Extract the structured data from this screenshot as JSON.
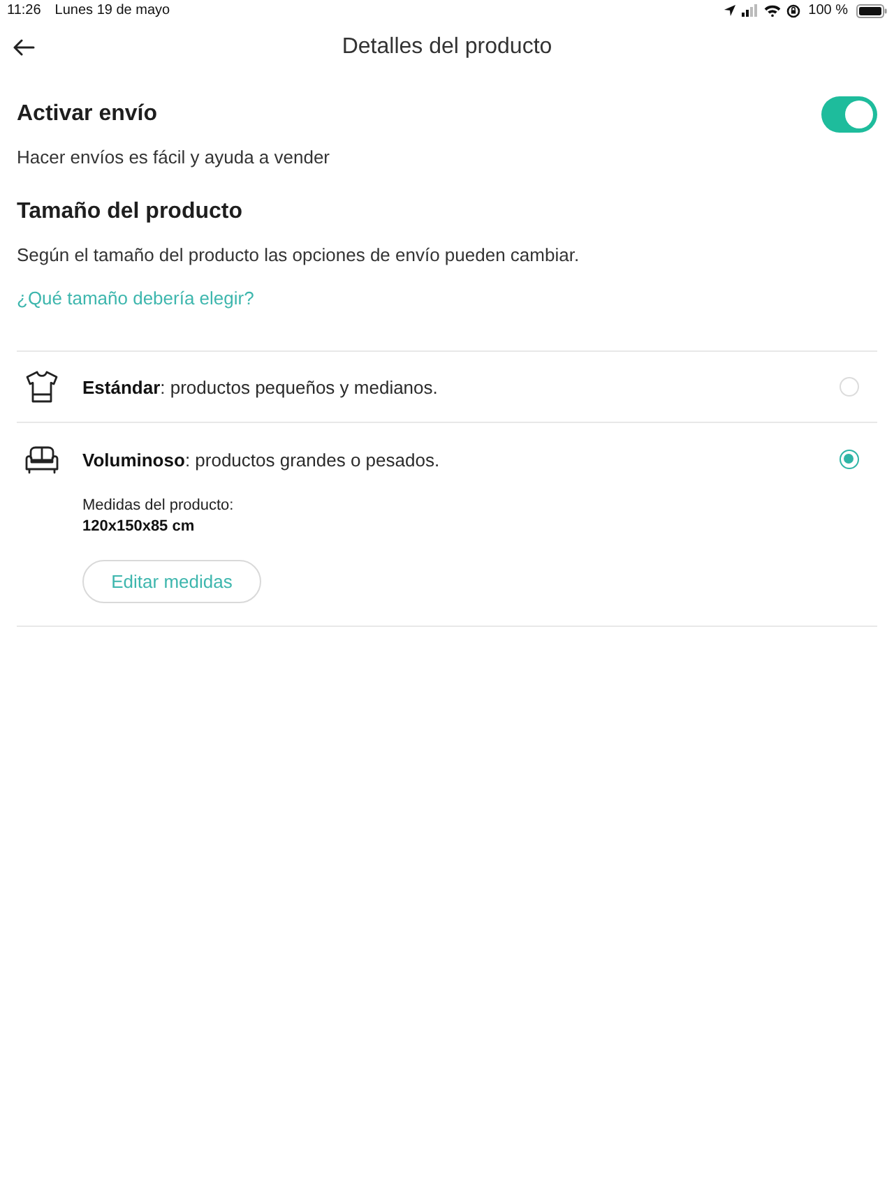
{
  "status_bar": {
    "time": "11:26",
    "date": "Lunes 19 de mayo",
    "battery_text": "100 %"
  },
  "header": {
    "title": "Detalles del producto"
  },
  "shipping": {
    "title": "Activar envío",
    "enabled": true,
    "description": "Hacer envíos es fácil y ayuda a vender"
  },
  "size": {
    "title": "Tamaño del producto",
    "description": "Según el tamaño del producto las opciones de envío pueden cambiar.",
    "link": "¿Qué tamaño debería elegir?"
  },
  "options": [
    {
      "label": "**Estándar**: productos pequeños y medianos.",
      "selected": false
    },
    {
      "label": "**Voluminoso**: productos grandes o pesados.",
      "selected": true,
      "details": {
        "label": "Medidas del producto:",
        "value": "120x150x85 cm",
        "button": "Editar medidas"
      }
    }
  ]
}
